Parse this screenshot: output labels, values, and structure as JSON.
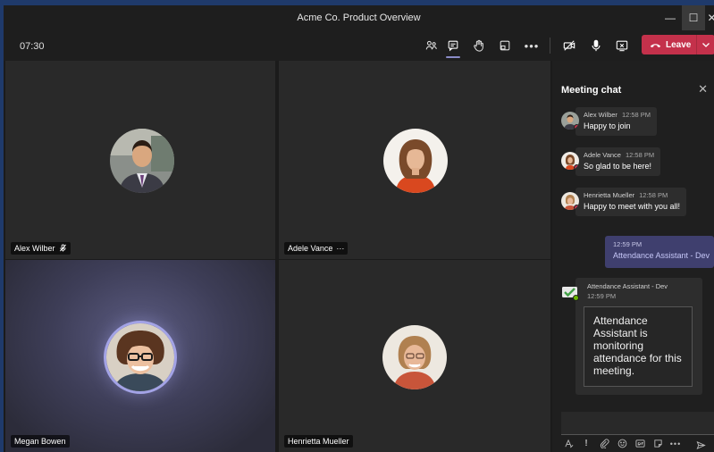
{
  "window": {
    "title": "Acme Co. Product Overview",
    "controls": {
      "minimize": "—",
      "maximize": "☐",
      "close": "✕"
    }
  },
  "toolbar": {
    "timer": "07:30",
    "leave_label": "Leave",
    "icons": [
      "people-icon",
      "chat-icon",
      "raise-hand-icon",
      "share-tray-icon",
      "more-icon",
      "camera-off-icon",
      "microphone-icon",
      "share-screen-stop-icon",
      "phone-hangup-icon",
      "chevron-down-icon"
    ]
  },
  "participants": [
    {
      "name": "Alex Wilber",
      "status_icon": "mic-off-icon",
      "status_glyph": "🎤̸"
    },
    {
      "name": "Adele Vance",
      "status_icon": "more-icon",
      "status_glyph": "···"
    },
    {
      "name": "Megan Bowen",
      "speaking": true
    },
    {
      "name": "Henrietta Mueller"
    }
  ],
  "chat": {
    "title": "Meeting chat",
    "close_glyph": "✕",
    "messages": [
      {
        "sender": "Alex Wilber",
        "time": "12:58 PM",
        "text": "Happy to join"
      },
      {
        "sender": "Adele Vance",
        "time": "12:58 PM",
        "text": "So glad to be here!"
      },
      {
        "sender": "Henrietta Mueller",
        "time": "12:58 PM",
        "text": "Happy to meet with you all!"
      }
    ],
    "my_message": {
      "time": "12:59 PM",
      "text": "Attendance Assistant - Dev"
    },
    "bot_message": {
      "sender": "Attendance Assistant - Dev",
      "time": "12:59 PM",
      "card_text": "Attendance Assistant is monitoring attendance for this meeting."
    },
    "compose_icons": [
      "format-icon",
      "important-icon",
      "attach-icon",
      "emoji-icon",
      "gif-icon",
      "sticker-icon",
      "more-icon",
      "send-icon"
    ]
  },
  "colors": {
    "leave": "#c4314b",
    "accent": "#8b8cc7",
    "my_message_bg": "#3f3f6e",
    "presence_busy": "#c4314b",
    "presence_available": "#6bb700"
  }
}
